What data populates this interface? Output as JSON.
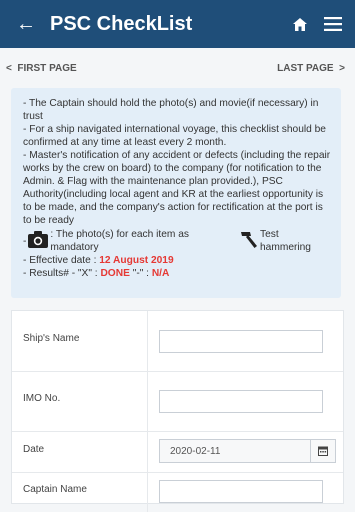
{
  "header": {
    "title": "PSC CheckList",
    "back_icon": "back-arrow-icon",
    "home_icon": "home-icon",
    "menu_icon": "menu-icon",
    "color": "#1f4e79"
  },
  "pager": {
    "first": "FIRST PAGE",
    "last": "LAST PAGE",
    "prev_glyph": "<",
    "next_glyph": ">"
  },
  "notice": {
    "lines": [
      "- The Captain should hold the photo(s) and movie(if necessary) in trust",
      "- For a ship navigated international voyage, this checklist should be confirmed at any time at least every 2 month.",
      "- Master's notification of any accident or defects (including the repair works by the crew on board) to the company (for notification to the Admin. & Flag with the maintenance plan provided.), PSC Authority(including local agent and KR at the earliest opportunity is to be made, and the company's action for rectification at the port is to be ready"
    ],
    "icon_prefix": "-",
    "photo_text": ": The photo(s) for each item as mandatory",
    "hammer_text": "Test hammering",
    "effective_label": "- Effective date : ",
    "effective_date": "12 August 2019",
    "results_label": "- Results# - \"X\" : ",
    "results_done": "DONE",
    "results_mid": "  \"-\" : ",
    "results_na": "N/A",
    "accent": "#e53935"
  },
  "form": {
    "rows": [
      {
        "label": "Ship's Name",
        "value": ""
      },
      {
        "label": "IMO No.",
        "value": ""
      },
      {
        "label": "Date",
        "value": "2020-02-11"
      },
      {
        "label": "Captain Name",
        "value": ""
      }
    ]
  }
}
